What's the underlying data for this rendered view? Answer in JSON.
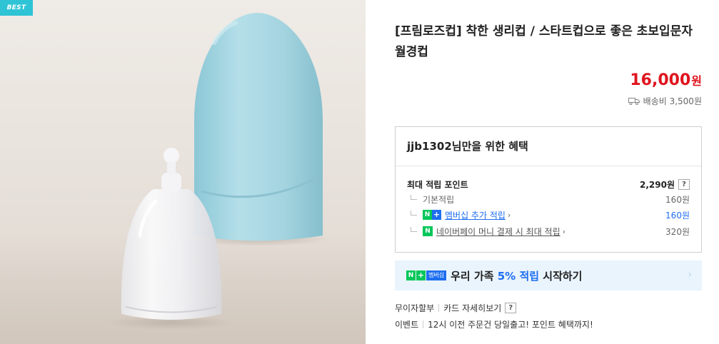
{
  "image": {
    "badge": "BEST",
    "icons": [
      "menstrual-cup",
      "cup-case"
    ],
    "colors": {
      "case": "#a9d7e2",
      "background": "#ebe6e0"
    }
  },
  "product": {
    "title": "[프림로즈컵] 착한 생리컵 / 스타트컵으로 좋은 초보입문자 월경컵",
    "price": "16,000",
    "price_unit": "원",
    "shipping": "배송비 3,500원"
  },
  "benefit": {
    "title": "jjb1302님만을 위한 혜택",
    "max_points_label": "최대 적립 포인트",
    "max_points_value": "2,290원",
    "help": "?",
    "rows": [
      {
        "label": "기본적립",
        "value": "160원"
      },
      {
        "badge_n": "N",
        "badge_plus": "+",
        "label": "멤버십 추가 적립",
        "value": "160원"
      },
      {
        "badge": "N",
        "label": "네이버페이 머니 결제 시 최대 적립",
        "value": "320원"
      }
    ]
  },
  "promo": {
    "badge_n": "N",
    "badge_plus": "+",
    "badge_mem": "멤버십",
    "text_before": "우리 가족 ",
    "highlight": "5% 적립",
    "text_after": " 시작하기",
    "arrow": "›"
  },
  "options": {
    "installment": "무이자할부",
    "card_details": "카드 자세히보기",
    "help": "?",
    "event_label": "이벤트",
    "event_text": "12시 이전 주문건 당일출고! 포인트 혜택까지!"
  },
  "colors": {
    "price": "#e0141e",
    "naver_green": "#03c75a",
    "naver_blue": "#1e6ef0",
    "promo_bg": "#eaf4fd"
  }
}
